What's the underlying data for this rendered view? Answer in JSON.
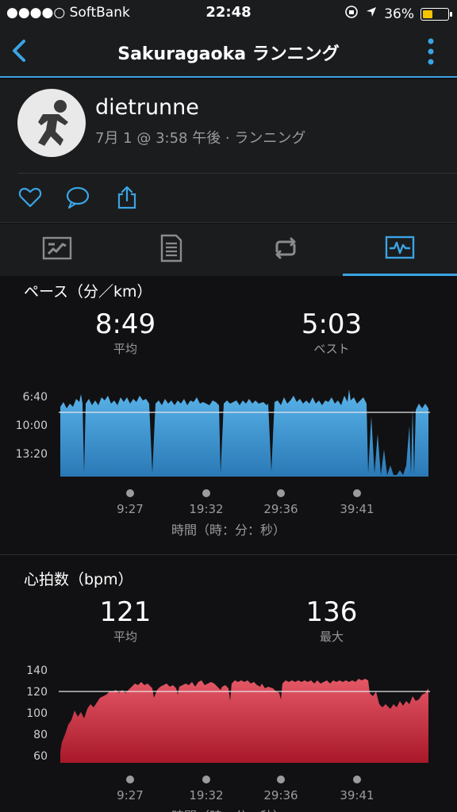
{
  "status_bar": {
    "carrier": "●●●●○ SoftBank",
    "time": "22:48",
    "battery": "36%"
  },
  "nav": {
    "title": "Sakuragaoka ランニング"
  },
  "profile": {
    "username": "dietrunne",
    "subline": "7月 1 @ 3:58 午後 · ランニング"
  },
  "pace": {
    "title": "ペース（分／km）",
    "avg_value": "8:49",
    "avg_label": "平均",
    "best_value": "5:03",
    "best_label": "ベスト",
    "y_ticks": [
      "6:40",
      "10:00",
      "13:20"
    ],
    "x_ticks": [
      "9:27",
      "19:32",
      "29:36",
      "39:41"
    ],
    "x_axis_title": "時間（時：分：秒）",
    "color": "#4aa3df"
  },
  "heart_rate": {
    "title": "心拍数（bpm）",
    "avg_value": "121",
    "avg_label": "平均",
    "max_value": "136",
    "max_label": "最大",
    "y_ticks": [
      "140",
      "120",
      "100",
      "80",
      "60"
    ],
    "x_ticks": [
      "9:27",
      "19:32",
      "29:36",
      "39:41"
    ],
    "x_axis_title": "時間（時：分：秒）",
    "color": "#d8404f"
  }
}
